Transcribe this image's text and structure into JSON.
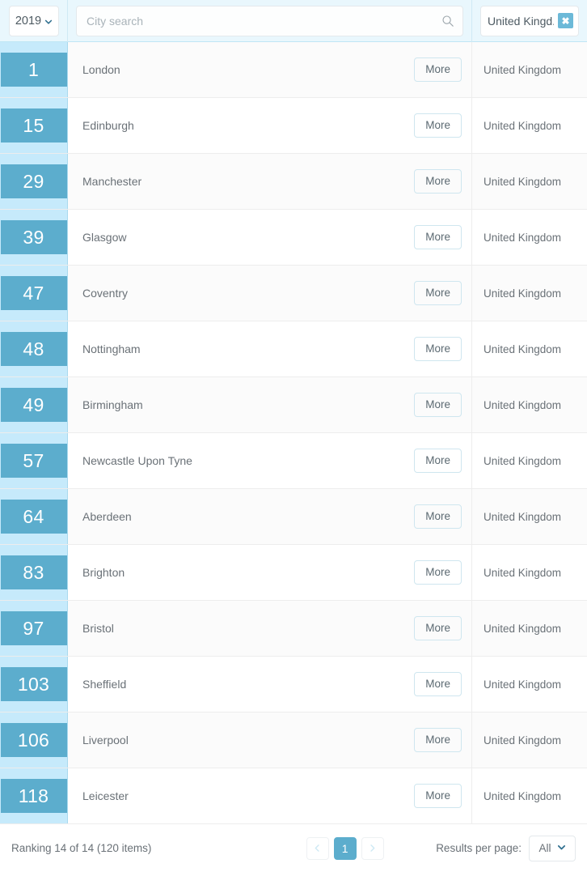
{
  "filters": {
    "year": {
      "value": "2019",
      "icon": "chevron-down-icon"
    },
    "search": {
      "value": "",
      "placeholder": "City search",
      "icon": "search-icon"
    },
    "country_chip": {
      "label": "United Kingd...",
      "remove_label": "✖",
      "remove_icon": "close-icon"
    }
  },
  "table": {
    "rows": [
      {
        "rank": "1",
        "city": "London",
        "country": "United Kingdom",
        "more": "More"
      },
      {
        "rank": "15",
        "city": "Edinburgh",
        "country": "United Kingdom",
        "more": "More"
      },
      {
        "rank": "29",
        "city": "Manchester",
        "country": "United Kingdom",
        "more": "More"
      },
      {
        "rank": "39",
        "city": "Glasgow",
        "country": "United Kingdom",
        "more": "More"
      },
      {
        "rank": "47",
        "city": "Coventry",
        "country": "United Kingdom",
        "more": "More"
      },
      {
        "rank": "48",
        "city": "Nottingham",
        "country": "United Kingdom",
        "more": "More"
      },
      {
        "rank": "49",
        "city": "Birmingham",
        "country": "United Kingdom",
        "more": "More"
      },
      {
        "rank": "57",
        "city": "Newcastle Upon Tyne",
        "country": "United Kingdom",
        "more": "More"
      },
      {
        "rank": "64",
        "city": "Aberdeen",
        "country": "United Kingdom",
        "more": "More"
      },
      {
        "rank": "83",
        "city": "Brighton",
        "country": "United Kingdom",
        "more": "More"
      },
      {
        "rank": "97",
        "city": "Bristol",
        "country": "United Kingdom",
        "more": "More"
      },
      {
        "rank": "103",
        "city": "Sheffield",
        "country": "United Kingdom",
        "more": "More"
      },
      {
        "rank": "106",
        "city": "Liverpool",
        "country": "United Kingdom",
        "more": "More"
      },
      {
        "rank": "118",
        "city": "Leicester",
        "country": "United Kingdom",
        "more": "More"
      }
    ]
  },
  "footer": {
    "summary": "Ranking 14 of 14 (120 items)",
    "pagination": {
      "prev_icon": "chevron-left-icon",
      "next_icon": "chevron-right-icon",
      "prev_label": "‹",
      "next_label": "›",
      "current_page": "1"
    },
    "results_per_page": {
      "label": "Results per page:",
      "value": "All",
      "icon": "chevron-down-icon"
    }
  },
  "colors": {
    "accent": "#5cadcd",
    "rank_column_bg": "#c6eafb",
    "header_bg": "#e9f7fd",
    "chip_remove_bg": "#6cb9d8",
    "row_alt_bg": "#fbfbfb",
    "text_muted": "#6a7177"
  }
}
